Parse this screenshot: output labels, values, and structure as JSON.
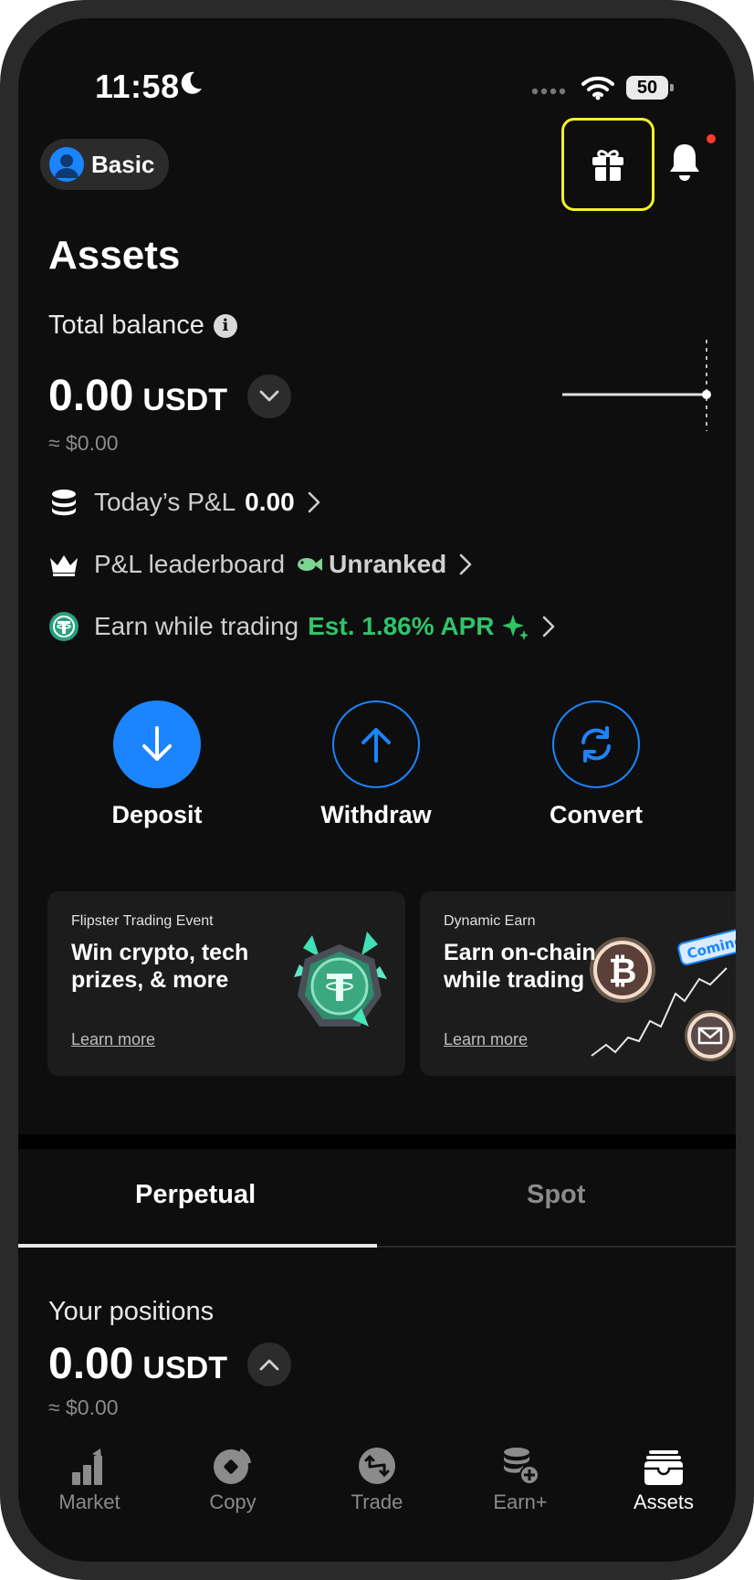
{
  "status_bar": {
    "time": "11:58",
    "battery": "50"
  },
  "header": {
    "tier_label": "Basic"
  },
  "page": {
    "title": "Assets"
  },
  "balance": {
    "label": "Total balance",
    "amount": "0.00",
    "currency": "USDT",
    "approx": "≈ $0.00"
  },
  "rows": {
    "pnl": {
      "label": "Today’s P&L",
      "value": "0.00"
    },
    "leaderboard": {
      "label": "P&L leaderboard",
      "value": "Unranked"
    },
    "earn": {
      "label": "Earn while trading",
      "value": "Est. 1.86% APR"
    }
  },
  "actions": [
    {
      "label": "Deposit"
    },
    {
      "label": "Withdraw"
    },
    {
      "label": "Convert"
    }
  ],
  "promos": [
    {
      "subtitle": "Flipster Trading Event",
      "title_line1": "Win crypto, tech",
      "title_line2": "prizes, & more",
      "link": "Learn more"
    },
    {
      "subtitle": "Dynamic Earn",
      "title_line1": "Earn on-chain",
      "title_line2": "while trading",
      "link": "Learn more",
      "badge": "Coming"
    }
  ],
  "tabs": [
    {
      "label": "Perpetual",
      "active": true
    },
    {
      "label": "Spot",
      "active": false
    }
  ],
  "positions": {
    "label": "Your positions",
    "amount": "0.00",
    "currency": "USDT",
    "approx": "≈ $0.00"
  },
  "bottom_nav": [
    {
      "label": "Market",
      "icon": "market-icon"
    },
    {
      "label": "Copy",
      "icon": "copy-icon"
    },
    {
      "label": "Trade",
      "icon": "trade-icon"
    },
    {
      "label": "Earn+",
      "icon": "earn-icon"
    },
    {
      "label": "Assets",
      "icon": "wallet-icon",
      "active": true
    }
  ],
  "colors": {
    "accent": "#1a85ff",
    "green": "#2fc36a",
    "highlight": "#f2f22a",
    "background": "#0e0e0e"
  }
}
